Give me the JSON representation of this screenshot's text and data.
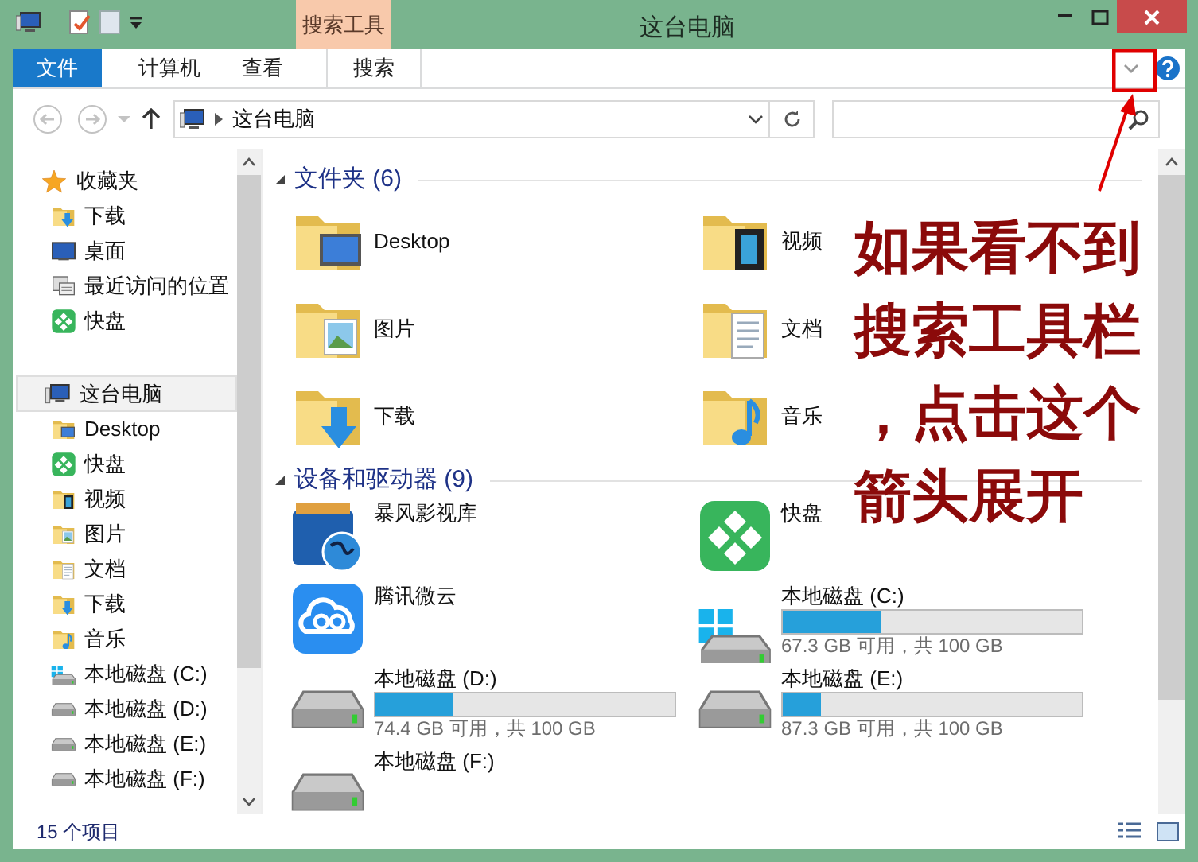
{
  "title_bar": {
    "context_tab": "搜索工具",
    "title": "这台电脑"
  },
  "ribbon": {
    "tabs": [
      {
        "label": "文件",
        "kind": "file"
      },
      {
        "label": "计算机",
        "kind": "tab"
      },
      {
        "label": "查看",
        "kind": "tab"
      },
      {
        "label": "搜索",
        "kind": "context"
      }
    ]
  },
  "address_bar": {
    "path": "这台电脑"
  },
  "nav_pane": {
    "items": [
      {
        "label": "收藏夹",
        "kind": "star",
        "selected": false,
        "children": [
          {
            "label": "下载",
            "kind": "download",
            "selected": false
          },
          {
            "label": "桌面",
            "kind": "monitor",
            "selected": false
          },
          {
            "label": "最近访问的位置",
            "kind": "recent",
            "selected": false
          },
          {
            "label": "快盘",
            "kind": "kuaipan",
            "selected": false
          }
        ]
      },
      {
        "label": "这台电脑",
        "kind": "pc",
        "selected": true,
        "children": [
          {
            "label": "Desktop",
            "kind": "desktop",
            "selected": false
          },
          {
            "label": "快盘",
            "kind": "kuaipan",
            "selected": false
          },
          {
            "label": "视频",
            "kind": "video",
            "selected": false
          },
          {
            "label": "图片",
            "kind": "pictures",
            "selected": false
          },
          {
            "label": "文档",
            "kind": "docs",
            "selected": false
          },
          {
            "label": "下载",
            "kind": "download",
            "selected": false
          },
          {
            "label": "音乐",
            "kind": "music",
            "selected": false
          },
          {
            "label": "本地磁盘 (C:)",
            "kind": "drive-win",
            "selected": false
          },
          {
            "label": "本地磁盘 (D:)",
            "kind": "drive",
            "selected": false
          },
          {
            "label": "本地磁盘 (E:)",
            "kind": "drive",
            "selected": false
          },
          {
            "label": "本地磁盘 (F:)",
            "kind": "drive",
            "selected": false
          }
        ]
      }
    ]
  },
  "content": {
    "groups": [
      {
        "title": "文件夹 (6)",
        "items": [
          {
            "label": "Desktop",
            "kind": "desktop"
          },
          {
            "label": "视频",
            "kind": "video"
          },
          {
            "label": "图片",
            "kind": "pictures"
          },
          {
            "label": "文档",
            "kind": "docs"
          },
          {
            "label": "下载",
            "kind": "download"
          },
          {
            "label": "音乐",
            "kind": "music"
          }
        ]
      },
      {
        "title": "设备和驱动器 (9)",
        "items": [
          {
            "label": "暴风影视库",
            "kind": "baofeng"
          },
          {
            "label": "快盘",
            "kind": "kuaipan"
          },
          {
            "label": "腾讯微云",
            "kind": "weiyun"
          },
          {
            "label": "本地磁盘 (C:)",
            "kind": "drive-win",
            "level": 0.33,
            "reading": "67.3 GB 可用，共 100 GB"
          },
          {
            "label": "本地磁盘 (D:)",
            "kind": "drive",
            "level": 0.26,
            "reading": "74.4 GB 可用，共 100 GB"
          },
          {
            "label": "本地磁盘 (E:)",
            "kind": "drive",
            "level": 0.13,
            "reading": "87.3 GB 可用，共 100 GB"
          },
          {
            "label": "本地磁盘 (F:)",
            "kind": "drive"
          }
        ]
      }
    ]
  },
  "status_bar": {
    "count": "15 个项目"
  },
  "annotation": {
    "text": "如果看不到搜索工具栏，点击这个箭头展开"
  }
}
